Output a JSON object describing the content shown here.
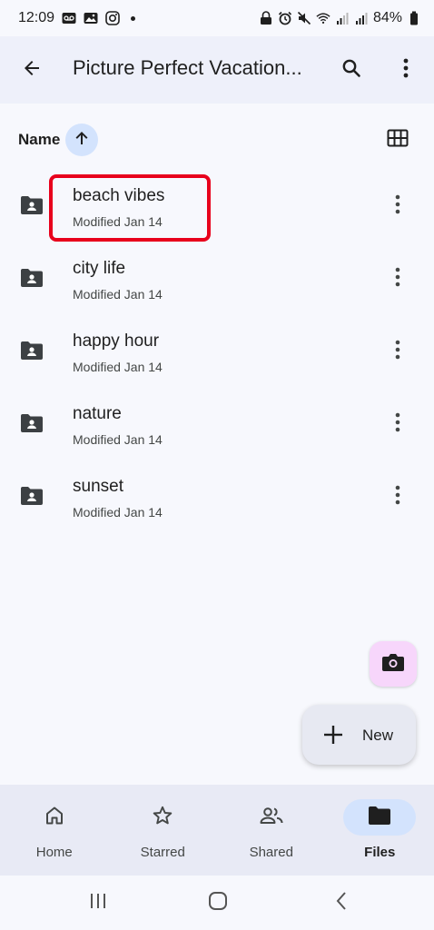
{
  "status_bar": {
    "time": "12:09",
    "battery": "84%",
    "icons": [
      "voicemail-icon",
      "gallery-icon",
      "instagram-icon",
      "dot-icon",
      "lock-icon",
      "alarm-icon",
      "mute-icon",
      "wifi-icon",
      "signal-icon",
      "signal-icon",
      "battery-icon"
    ]
  },
  "app_bar": {
    "title": "Picture Perfect Vacation...",
    "icons": [
      "back-arrow-icon",
      "search-icon",
      "more-vert-icon"
    ]
  },
  "sort": {
    "label": "Name",
    "direction_icon": "arrow-up-icon",
    "view_icon": "grid-view-icon"
  },
  "files": [
    {
      "name": "beach vibes",
      "meta": "Modified Jan 14",
      "icon": "shared-folder-icon"
    },
    {
      "name": "city life",
      "meta": "Modified Jan 14",
      "icon": "shared-folder-icon"
    },
    {
      "name": "happy hour",
      "meta": "Modified Jan 14",
      "icon": "shared-folder-icon"
    },
    {
      "name": "nature",
      "meta": "Modified Jan 14",
      "icon": "shared-folder-icon"
    },
    {
      "name": "sunset",
      "meta": "Modified Jan 14",
      "icon": "shared-folder-icon"
    }
  ],
  "fab": {
    "camera_icon": "camera-icon",
    "new_label": "New",
    "new_icon": "plus-icon"
  },
  "bottom_nav": {
    "items": [
      {
        "label": "Home",
        "icon": "home-icon",
        "active": false
      },
      {
        "label": "Starred",
        "icon": "star-icon",
        "active": false
      },
      {
        "label": "Shared",
        "icon": "people-icon",
        "active": false
      },
      {
        "label": "Files",
        "icon": "folder-icon",
        "active": true
      }
    ]
  },
  "colors": {
    "accent": "#d3e3fd",
    "highlight": "#e8001c",
    "camera_fab": "#f7d6fb"
  }
}
